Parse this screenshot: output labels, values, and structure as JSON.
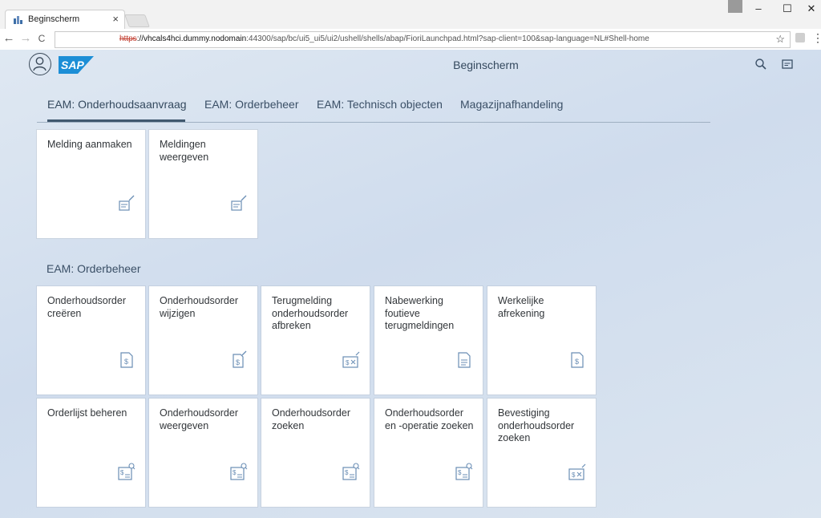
{
  "browser": {
    "tab_title": "Beginscherm",
    "tab_close": "×",
    "url_scheme": "https",
    "url_host": "://vhcals4hci.dummy.nodomain",
    "url_rest": ":44300/sap/bc/ui5_ui5/ui2/ushell/shells/abap/FioriLaunchpad.html?sap-client=100&sap-language=NL#Shell-home",
    "back": "←",
    "forward": "→",
    "reload": "C",
    "star": "☆",
    "menu": "⋮",
    "minimize": "–",
    "maximize": "☐",
    "close": "✕"
  },
  "shell": {
    "title": "Beginscherm",
    "logo_text": "SAP"
  },
  "tabs": [
    {
      "label": "EAM: Onderhoudsaanvraag"
    },
    {
      "label": "EAM: Orderbeheer"
    },
    {
      "label": "EAM: Technisch objecten"
    },
    {
      "label": "Magazijnafhandeling"
    }
  ],
  "groups": [
    {
      "title": "",
      "tiles": [
        {
          "label": "Melding aanmaken",
          "icon": "notification-create-icon"
        },
        {
          "label": "Meldingen weergeven",
          "icon": "notification-display-icon"
        }
      ]
    },
    {
      "title": "EAM: Orderbeheer",
      "tiles": [
        {
          "label": "Onderhoudsorder creëren",
          "icon": "order-document-icon"
        },
        {
          "label": "Onderhoudsorder wijzigen",
          "icon": "order-edit-icon"
        },
        {
          "label": "Terugmelding onderhoudsorder afbreken",
          "icon": "confirmation-cancel-icon"
        },
        {
          "label": "Nabewerking foutieve terugmeldingen",
          "icon": "error-document-icon"
        },
        {
          "label": "Werkelijke afrekening",
          "icon": "settlement-document-icon"
        },
        {
          "label": "Orderlijst beheren",
          "icon": "order-search-icon"
        },
        {
          "label": "Onderhoudsorder weergeven",
          "icon": "order-search-icon"
        },
        {
          "label": "Onderhoudsorder zoeken",
          "icon": "order-search-icon"
        },
        {
          "label": "Onderhoudsorder en -operatie zoeken",
          "icon": "order-search-icon"
        },
        {
          "label": "Bevestiging onderhoudsorder zoeken",
          "icon": "confirmation-cancel-icon"
        }
      ]
    }
  ],
  "colors": {
    "accent": "#40586f",
    "sap_blue": "#1c8ed6",
    "icon_blue": "#6a8eb5"
  }
}
